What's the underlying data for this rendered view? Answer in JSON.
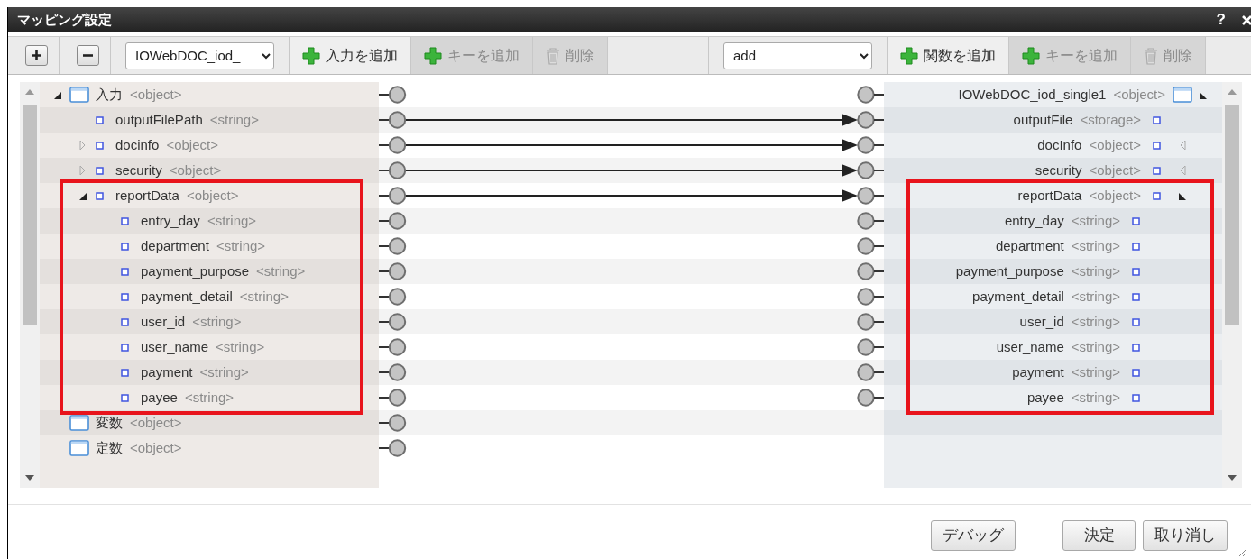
{
  "dialog": {
    "title": "マッピング設定",
    "help": "?"
  },
  "toolbar": [
    {
      "kind": "expand-all"
    },
    {
      "kind": "collapse-all"
    },
    {
      "kind": "select",
      "value": "IOWebDOC_iod_"
    },
    {
      "kind": "add",
      "label": "入力を追加",
      "disabled": false
    },
    {
      "kind": "add",
      "label": "キーを追加",
      "disabled": true
    },
    {
      "kind": "delete",
      "label": "削除",
      "disabled": true
    },
    {
      "kind": "spacer"
    },
    {
      "kind": "select",
      "value": "add"
    },
    {
      "kind": "add",
      "label": "関数を追加",
      "disabled": false
    },
    {
      "kind": "add",
      "label": "キーを追加",
      "disabled": true
    },
    {
      "kind": "delete",
      "label": "削除",
      "disabled": true
    }
  ],
  "source_tree": [
    {
      "kind": "folder",
      "name": "入力",
      "type": "<object>",
      "expanded": true,
      "mapped": false,
      "highlighted": false,
      "children": [
        {
          "kind": "field",
          "name": "outputFilePath",
          "type": "<string>",
          "mapped": true,
          "highlighted": false
        },
        {
          "kind": "field",
          "name": "docinfo",
          "type": "<object>",
          "expanded": false,
          "mapped": true,
          "highlighted": false
        },
        {
          "kind": "field",
          "name": "security",
          "type": "<object>",
          "expanded": false,
          "mapped": true,
          "highlighted": false
        },
        {
          "kind": "field",
          "name": "reportData",
          "type": "<object>",
          "expanded": true,
          "mapped": true,
          "highlighted": true,
          "children": [
            {
              "kind": "field",
              "name": "entry_day",
              "type": "<string>",
              "mapped": false,
              "highlighted": false
            },
            {
              "kind": "field",
              "name": "department",
              "type": "<string>",
              "mapped": false,
              "highlighted": false
            },
            {
              "kind": "field",
              "name": "payment_purpose",
              "type": "<string>",
              "mapped": false,
              "highlighted": false
            },
            {
              "kind": "field",
              "name": "payment_detail",
              "type": "<string>",
              "mapped": false,
              "highlighted": false
            },
            {
              "kind": "field",
              "name": "user_id",
              "type": "<string>",
              "mapped": false,
              "highlighted": false
            },
            {
              "kind": "field",
              "name": "user_name",
              "type": "<string>",
              "mapped": false,
              "highlighted": false
            },
            {
              "kind": "field",
              "name": "payment",
              "type": "<string>",
              "mapped": false,
              "highlighted": false
            },
            {
              "kind": "field",
              "name": "payee",
              "type": "<string>",
              "mapped": false,
              "highlighted": false
            }
          ]
        }
      ]
    },
    {
      "kind": "folder",
      "name": "変数",
      "type": "<object>",
      "mapped": false,
      "highlighted": false
    },
    {
      "kind": "folder",
      "name": "定数",
      "type": "<object>",
      "mapped": false,
      "highlighted": false
    }
  ],
  "target_tree": [
    {
      "kind": "folder",
      "name": "IOWebDOC_iod_single1",
      "type": "<object>",
      "expanded": true,
      "highlighted": false,
      "children": [
        {
          "kind": "field",
          "name": "outputFile",
          "type": "<storage>",
          "highlighted": false
        },
        {
          "kind": "field",
          "name": "docInfo",
          "type": "<object>",
          "expanded": false,
          "highlighted": false
        },
        {
          "kind": "field",
          "name": "security",
          "type": "<object>",
          "expanded": false,
          "highlighted": false
        },
        {
          "kind": "field",
          "name": "reportData",
          "type": "<object>",
          "expanded": true,
          "highlighted": true,
          "children": [
            {
              "kind": "field",
              "name": "entry_day",
              "type": "<string>",
              "highlighted": false
            },
            {
              "kind": "field",
              "name": "department",
              "type": "<string>",
              "highlighted": false
            },
            {
              "kind": "field",
              "name": "payment_purpose",
              "type": "<string>",
              "highlighted": false
            },
            {
              "kind": "field",
              "name": "payment_detail",
              "type": "<string>",
              "highlighted": false
            },
            {
              "kind": "field",
              "name": "user_id",
              "type": "<string>",
              "highlighted": false
            },
            {
              "kind": "field",
              "name": "user_name",
              "type": "<string>",
              "highlighted": false
            },
            {
              "kind": "field",
              "name": "payment",
              "type": "<string>",
              "highlighted": false
            },
            {
              "kind": "field",
              "name": "payee",
              "type": "<string>",
              "highlighted": false
            }
          ]
        }
      ]
    }
  ],
  "footer_buttons": [
    {
      "label": "デバッグ"
    },
    {
      "label": "決定"
    },
    {
      "label": "取り消し"
    }
  ]
}
